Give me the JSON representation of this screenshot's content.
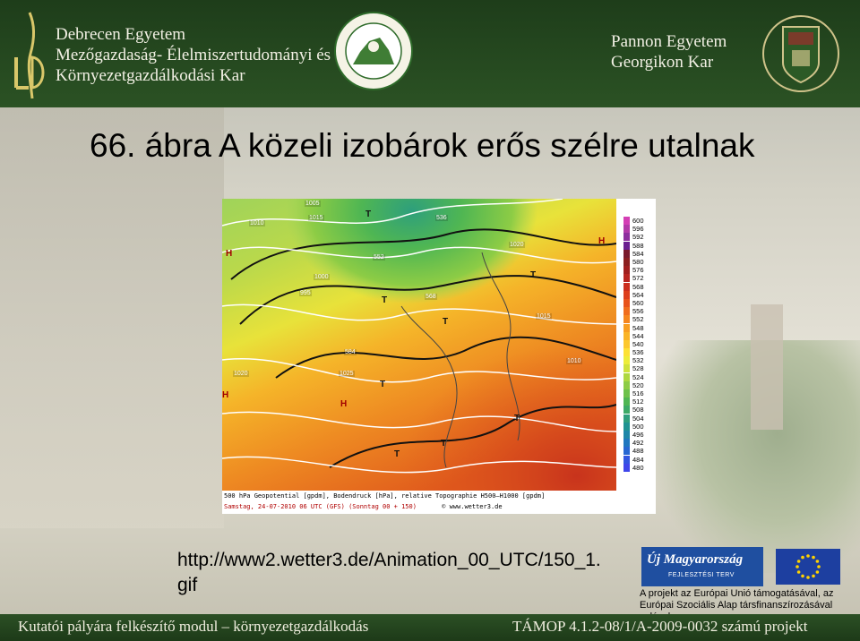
{
  "header": {
    "left_lines": [
      "Debrecen Egyetem",
      "Mezőgazdaság- Élelmiszertudományi és",
      "Környezetgazdálkodási Kar"
    ],
    "right_lines": [
      "Pannon Egyetem",
      "Georgikon Kar"
    ]
  },
  "title": "66. ábra A közeli izobárok erős szélre utalnak",
  "url_text": "http://www2.wetter3.de/Animation_00_UTC/150_1.gif",
  "map": {
    "caption_line1": "500 hPa Geopotential [gpdm], Bodendruck [hPa], relative Topographie H500—H1000 [gpdm]",
    "caption_line2": "Samstag, 24-07-2010 06 UTC      (GFS)  (Sonntag 00 + 150)",
    "site": "© www.wetter3.de",
    "legend": [
      600,
      596,
      592,
      588,
      584,
      580,
      576,
      572,
      568,
      564,
      560,
      556,
      552,
      548,
      544,
      540,
      536,
      532,
      528,
      524,
      520,
      516,
      512,
      508,
      504,
      500,
      496,
      492,
      488,
      484,
      480
    ],
    "legend_colors": [
      "#d43fb5",
      "#b23aa8",
      "#8d2f9e",
      "#6a1e90",
      "#7a1a2a",
      "#8b1f1f",
      "#a01e1e",
      "#b82420",
      "#cc2e1e",
      "#dd3e1c",
      "#e8531c",
      "#f06d1e",
      "#f5861f",
      "#f89e22",
      "#fab427",
      "#fcc82e",
      "#fde135",
      "#eded3a",
      "#cfe23c",
      "#aed840",
      "#8dcc45",
      "#6dc14b",
      "#4fb653",
      "#3caa66",
      "#2e9f7c",
      "#1f9391",
      "#1d86a8",
      "#1f77bf",
      "#2767d2",
      "#3256e0",
      "#3f46ea"
    ],
    "iso_labels": [
      "1005",
      "1010",
      "1015",
      "1020",
      "1025",
      "1000",
      "995",
      "552",
      "568",
      "584",
      "536",
      "1020",
      "1015",
      "1010"
    ],
    "symbols": [
      "H",
      "T"
    ]
  },
  "eu_note": "A projekt az Európai Unió támogatásával, az Európai Szociális Alap társfinanszírozásával valósul meg",
  "eu_logo_text": "Új Magyarország",
  "eu_logo_sub": "FEJLESZTÉSI TERV",
  "footer": {
    "left": "Kutatói pályára felkészítő modul – környezetgazdálkodás",
    "right": "TÁMOP 4.1.2-08/1/A-2009-0032 számú projekt"
  }
}
